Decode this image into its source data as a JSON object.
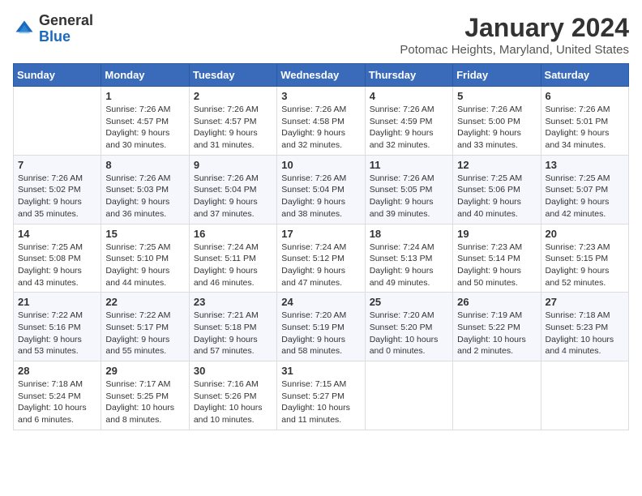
{
  "logo": {
    "general": "General",
    "blue": "Blue"
  },
  "header": {
    "month_year": "January 2024",
    "location": "Potomac Heights, Maryland, United States"
  },
  "weekdays": [
    "Sunday",
    "Monday",
    "Tuesday",
    "Wednesday",
    "Thursday",
    "Friday",
    "Saturday"
  ],
  "weeks": [
    [
      {
        "day": "",
        "info": ""
      },
      {
        "day": "1",
        "info": "Sunrise: 7:26 AM\nSunset: 4:57 PM\nDaylight: 9 hours\nand 30 minutes."
      },
      {
        "day": "2",
        "info": "Sunrise: 7:26 AM\nSunset: 4:57 PM\nDaylight: 9 hours\nand 31 minutes."
      },
      {
        "day": "3",
        "info": "Sunrise: 7:26 AM\nSunset: 4:58 PM\nDaylight: 9 hours\nand 32 minutes."
      },
      {
        "day": "4",
        "info": "Sunrise: 7:26 AM\nSunset: 4:59 PM\nDaylight: 9 hours\nand 32 minutes."
      },
      {
        "day": "5",
        "info": "Sunrise: 7:26 AM\nSunset: 5:00 PM\nDaylight: 9 hours\nand 33 minutes."
      },
      {
        "day": "6",
        "info": "Sunrise: 7:26 AM\nSunset: 5:01 PM\nDaylight: 9 hours\nand 34 minutes."
      }
    ],
    [
      {
        "day": "7",
        "info": "Sunrise: 7:26 AM\nSunset: 5:02 PM\nDaylight: 9 hours\nand 35 minutes."
      },
      {
        "day": "8",
        "info": "Sunrise: 7:26 AM\nSunset: 5:03 PM\nDaylight: 9 hours\nand 36 minutes."
      },
      {
        "day": "9",
        "info": "Sunrise: 7:26 AM\nSunset: 5:04 PM\nDaylight: 9 hours\nand 37 minutes."
      },
      {
        "day": "10",
        "info": "Sunrise: 7:26 AM\nSunset: 5:04 PM\nDaylight: 9 hours\nand 38 minutes."
      },
      {
        "day": "11",
        "info": "Sunrise: 7:26 AM\nSunset: 5:05 PM\nDaylight: 9 hours\nand 39 minutes."
      },
      {
        "day": "12",
        "info": "Sunrise: 7:25 AM\nSunset: 5:06 PM\nDaylight: 9 hours\nand 40 minutes."
      },
      {
        "day": "13",
        "info": "Sunrise: 7:25 AM\nSunset: 5:07 PM\nDaylight: 9 hours\nand 42 minutes."
      }
    ],
    [
      {
        "day": "14",
        "info": "Sunrise: 7:25 AM\nSunset: 5:08 PM\nDaylight: 9 hours\nand 43 minutes."
      },
      {
        "day": "15",
        "info": "Sunrise: 7:25 AM\nSunset: 5:10 PM\nDaylight: 9 hours\nand 44 minutes."
      },
      {
        "day": "16",
        "info": "Sunrise: 7:24 AM\nSunset: 5:11 PM\nDaylight: 9 hours\nand 46 minutes."
      },
      {
        "day": "17",
        "info": "Sunrise: 7:24 AM\nSunset: 5:12 PM\nDaylight: 9 hours\nand 47 minutes."
      },
      {
        "day": "18",
        "info": "Sunrise: 7:24 AM\nSunset: 5:13 PM\nDaylight: 9 hours\nand 49 minutes."
      },
      {
        "day": "19",
        "info": "Sunrise: 7:23 AM\nSunset: 5:14 PM\nDaylight: 9 hours\nand 50 minutes."
      },
      {
        "day": "20",
        "info": "Sunrise: 7:23 AM\nSunset: 5:15 PM\nDaylight: 9 hours\nand 52 minutes."
      }
    ],
    [
      {
        "day": "21",
        "info": "Sunrise: 7:22 AM\nSunset: 5:16 PM\nDaylight: 9 hours\nand 53 minutes."
      },
      {
        "day": "22",
        "info": "Sunrise: 7:22 AM\nSunset: 5:17 PM\nDaylight: 9 hours\nand 55 minutes."
      },
      {
        "day": "23",
        "info": "Sunrise: 7:21 AM\nSunset: 5:18 PM\nDaylight: 9 hours\nand 57 minutes."
      },
      {
        "day": "24",
        "info": "Sunrise: 7:20 AM\nSunset: 5:19 PM\nDaylight: 9 hours\nand 58 minutes."
      },
      {
        "day": "25",
        "info": "Sunrise: 7:20 AM\nSunset: 5:20 PM\nDaylight: 10 hours\nand 0 minutes."
      },
      {
        "day": "26",
        "info": "Sunrise: 7:19 AM\nSunset: 5:22 PM\nDaylight: 10 hours\nand 2 minutes."
      },
      {
        "day": "27",
        "info": "Sunrise: 7:18 AM\nSunset: 5:23 PM\nDaylight: 10 hours\nand 4 minutes."
      }
    ],
    [
      {
        "day": "28",
        "info": "Sunrise: 7:18 AM\nSunset: 5:24 PM\nDaylight: 10 hours\nand 6 minutes."
      },
      {
        "day": "29",
        "info": "Sunrise: 7:17 AM\nSunset: 5:25 PM\nDaylight: 10 hours\nand 8 minutes."
      },
      {
        "day": "30",
        "info": "Sunrise: 7:16 AM\nSunset: 5:26 PM\nDaylight: 10 hours\nand 10 minutes."
      },
      {
        "day": "31",
        "info": "Sunrise: 7:15 AM\nSunset: 5:27 PM\nDaylight: 10 hours\nand 11 minutes."
      },
      {
        "day": "",
        "info": ""
      },
      {
        "day": "",
        "info": ""
      },
      {
        "day": "",
        "info": ""
      }
    ]
  ]
}
